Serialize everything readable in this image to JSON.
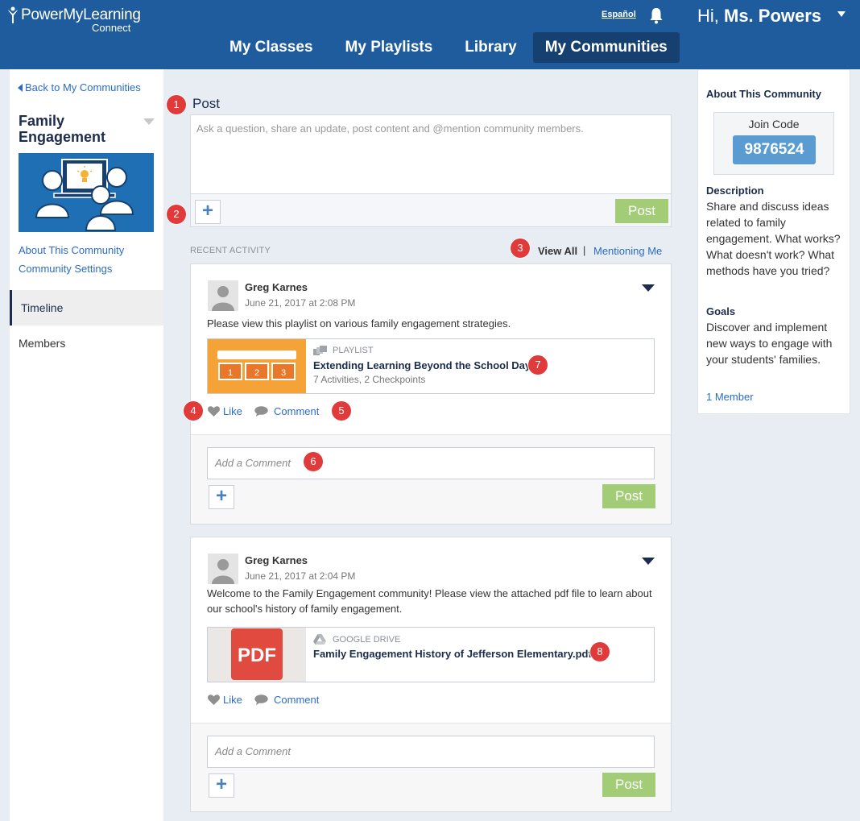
{
  "header": {
    "logo_main": "PowerMyLearning",
    "logo_sub": "Connect",
    "language_link": "Español",
    "greeting_prefix": "Hi, ",
    "user_name": "Ms. Powers",
    "nav": [
      "My Classes",
      "My Playlists",
      "Library",
      "My Communities"
    ],
    "active_nav": "My Communities"
  },
  "sidebar": {
    "back_link": "Back to My Communities",
    "community_title": "Family Engagement",
    "links": [
      "About This Community",
      "Community Settings"
    ],
    "nav": [
      "Timeline",
      "Members"
    ],
    "active_nav": "Timeline"
  },
  "composer": {
    "label": "Post",
    "placeholder": "Ask a question, share an update, post content and @mention community members.",
    "add_label": "+",
    "post_button": "Post"
  },
  "activity": {
    "section_label": "RECENT ACTIVITY",
    "view_all": "View All",
    "separator": "|",
    "mentioning_me": "Mentioning Me"
  },
  "posts": [
    {
      "author": "Greg Karnes",
      "timestamp": "June 21, 2017 at 2:08 PM",
      "body": "Please view this playlist on various family engagement strategies.",
      "attachment": {
        "type": "PLAYLIST",
        "title": "Extending Learning Beyond the School Day",
        "subtitle": "7 Activities, 2 Checkpoints",
        "thumb_steps": [
          "1",
          "2",
          "3"
        ]
      },
      "like": "Like",
      "comment": "Comment",
      "comment_placeholder": "Add a Comment",
      "add_label": "+",
      "post_button": "Post"
    },
    {
      "author": "Greg Karnes",
      "timestamp": "June 21, 2017 at 2:04 PM",
      "body": "Welcome to the Family Engagement community! Please view the attached pdf file to learn about our school's history of family engagement.",
      "attachment": {
        "type": "GOOGLE DRIVE",
        "title": "Family Engagement History of Jefferson Elementary.pdf",
        "thumb_label": "PDF"
      },
      "like": "Like",
      "comment": "Comment",
      "comment_placeholder": "Add a Comment",
      "add_label": "+",
      "post_button": "Post"
    }
  ],
  "about": {
    "title": "About This Community",
    "join_code_label": "Join Code",
    "join_code": "9876524",
    "description_label": "Description",
    "description": "Share and discuss ideas related to family engagement. What works? What doesn't work? What methods have you tried?",
    "goals_label": "Goals",
    "goals": "Discover and implement new ways to engage with your students' families.",
    "members": "1 Member"
  },
  "callouts": [
    "1",
    "2",
    "3",
    "4",
    "5",
    "6",
    "7",
    "8"
  ],
  "colors": {
    "header_bg": "#1f5c9e",
    "nav_active": "#16406f",
    "link": "#2b6cc4",
    "post_button": "#a2cd76",
    "callout": "#e03a3a",
    "join_code_bg": "#5a9bd1",
    "playlist_orange": "#f5a336",
    "pdf_red": "#e04a3f"
  }
}
